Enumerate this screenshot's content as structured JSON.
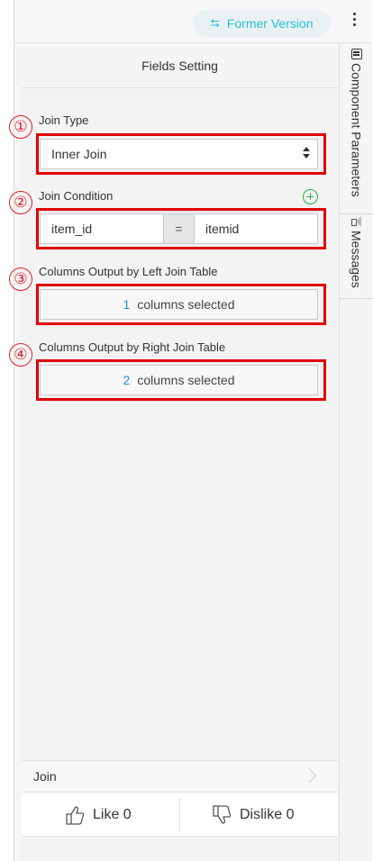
{
  "toolbar": {
    "former_version_label": "Former Version",
    "swap_icon": "swap-arrows-icon",
    "more_icon": "kebab-menu-icon"
  },
  "panel": {
    "title": "Fields Setting",
    "join_type": {
      "marker": "①",
      "label": "Join Type",
      "selected": "Inner Join"
    },
    "join_condition": {
      "marker": "②",
      "label": "Join Condition",
      "left_field": "item_id",
      "operator": "=",
      "right_field": "itemid"
    },
    "left_columns": {
      "marker": "③",
      "label": "Columns Output by Left Join Table",
      "count": "1",
      "suffix": "columns selected"
    },
    "right_columns": {
      "marker": "④",
      "label": "Columns Output by Right Join Table",
      "count": "2",
      "suffix": "columns selected"
    }
  },
  "footer": {
    "component_name": "Join",
    "like_label": "Like 0",
    "dislike_label": "Dislike 0"
  },
  "side_tabs": {
    "component_parameters": "Component Parameters",
    "messages": "Messages"
  },
  "colors": {
    "accent": "#26c2d4",
    "highlight": "#e00000",
    "add": "#22b14c",
    "count": "#1e90d6"
  }
}
